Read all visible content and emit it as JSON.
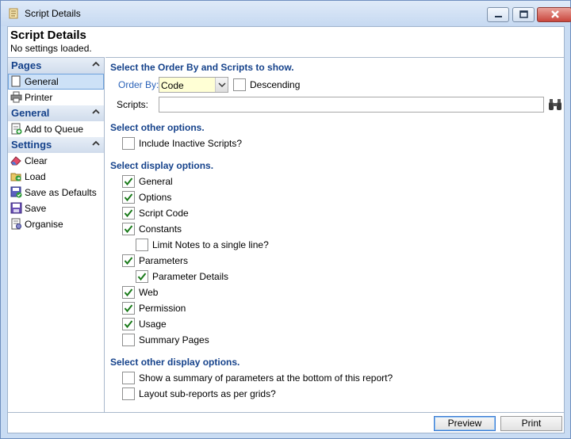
{
  "window": {
    "title": "Script Details",
    "controls": {
      "minimize": "minimize",
      "maximize": "maximize",
      "close": "close"
    }
  },
  "header": {
    "title": "Script Details",
    "subtitle": "No settings loaded."
  },
  "sidebar": {
    "groups": [
      {
        "label": "Pages",
        "items": [
          {
            "label": "General",
            "icon": "page-icon",
            "selected": true
          },
          {
            "label": "Printer",
            "icon": "printer-icon"
          }
        ]
      },
      {
        "label": "General",
        "items": [
          {
            "label": "Add to Queue",
            "icon": "queue-icon"
          }
        ]
      },
      {
        "label": "Settings",
        "items": [
          {
            "label": "Clear",
            "icon": "eraser-icon"
          },
          {
            "label": "Load",
            "icon": "load-icon"
          },
          {
            "label": "Save as Defaults",
            "icon": "save-defaults-icon"
          },
          {
            "label": "Save",
            "icon": "save-icon"
          },
          {
            "label": "Organise",
            "icon": "organise-icon"
          }
        ]
      }
    ]
  },
  "main": {
    "order_section": "Select the Order By and Scripts to show.",
    "order_by_label": "Order By:",
    "order_by_value": "Code",
    "descending_label": "Descending",
    "descending_checked": false,
    "scripts_label": "Scripts:",
    "scripts_value": "",
    "other_section": "Select other options.",
    "include_inactive_label": "Include Inactive Scripts?",
    "include_inactive_checked": false,
    "display_section": "Select display options.",
    "display_options": [
      {
        "label": "General",
        "checked": true
      },
      {
        "label": "Options",
        "checked": true
      },
      {
        "label": "Script Code",
        "checked": true
      },
      {
        "label": "Constants",
        "checked": true
      },
      {
        "label": "Limit Notes to a single line?",
        "checked": false
      },
      {
        "label": "Parameters",
        "checked": true
      },
      {
        "label": "Parameter Details",
        "checked": true
      },
      {
        "label": "Web",
        "checked": true
      },
      {
        "label": "Permission",
        "checked": true
      },
      {
        "label": "Usage",
        "checked": true
      },
      {
        "label": "Summary Pages",
        "checked": false
      }
    ],
    "other_display_section": "Select other display options.",
    "other_display_options": [
      {
        "label": "Show a summary of parameters at the bottom of this report?",
        "checked": false
      },
      {
        "label": "Layout sub-reports as per grids?",
        "checked": false
      }
    ]
  },
  "footer": {
    "preview_label": "Preview",
    "print_label": "Print"
  },
  "colors": {
    "section_header": "#15428b",
    "group_header_bg": "#d0dcec",
    "selection": "#cde1f7",
    "combo_bg": "#ffffd5",
    "check": "#1a7a1a"
  }
}
